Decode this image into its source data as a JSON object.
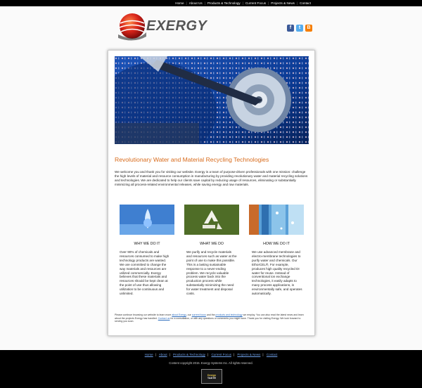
{
  "top_nav": [
    "Home",
    "About Us",
    "Products & Technology",
    "Current Focus",
    "Projects & News",
    "Contact"
  ],
  "logo": {
    "text": "EXERGY"
  },
  "social": [
    {
      "icon": "facebook-icon",
      "glyph": "f",
      "color": "#3b5998"
    },
    {
      "icon": "twitter-icon",
      "glyph": "t",
      "color": "#55acee"
    },
    {
      "icon": "blogger-icon",
      "glyph": "B",
      "color": "#f57d00"
    }
  ],
  "main": {
    "title": "Revolutionary Water and Material Recycling Technologies",
    "intro": "We welcome you and thank you for visiting our website. Exergy is a team of purpose-driven professionals with one mission: challenge the high levels of material and resource consumption in manufacturing by providing revolutionary water and material recycling solutions and technologies. We are dedicated to help our clients save capital by reducing usage of resources, eliminating or substantially minimizing all process-related environmental releases, while saving energy and raw materials.",
    "columns": [
      {
        "heading": "WHY WE DO IT",
        "text": "Over 90% of chemicals and resources consumed to make high technology products are wasted. We are committed to change the way materials and resources are utilized commercially. Exergy believes that these materials and resources should be kept clean at the point of use thus allowing utilization to be continuous and unlimited."
      },
      {
        "heading": "WHAT WE DO",
        "text": "We purify and recycle materials and resources such as water at the point of use to make this possible. This is a lasting sustainable response to a never-ending problem. We recycle valuable process water back into the production process while substantially minimizing the need for water treatment and disposal costs."
      },
      {
        "heading": "HOW WE DO IT",
        "text": "We use advanced membrane and electro-membrane technologies to purify water and chemicals. Our EthorCEL®, For example, produces high quality recycled DI water for reuse. Instead of conventional ion exchange technologies, it easily adapts to many process applications, is environmentally safe, and operates automatically."
      }
    ],
    "outro": {
      "p1": "Please continue browsing our website to learn more ",
      "l1": "about Exergy",
      "p2": ", our ",
      "l2": "current focus",
      "p3": " and the ",
      "l3": "products and technology",
      "p4": " we employ. You can also read the latest news and learn about the projects Exergy has handled. ",
      "l4": "Contact us",
      "p5": " for a consultation, or with any questions or comments you might have. Thank you for visiting Exergy. We look forward to serving you soon."
    }
  },
  "footer": {
    "nav": [
      "Home",
      "About",
      "Products & Technology",
      "Current Focus",
      "Projects & News",
      "Contact"
    ],
    "copyright": "Content copyright 2015. Exergy Systems Inc. All rights reserved.",
    "badge_line1": "Design",
    "badge_line2": "TASTE"
  }
}
